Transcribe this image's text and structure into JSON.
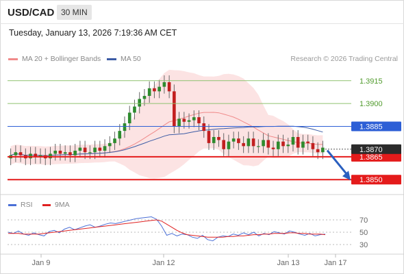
{
  "header": {
    "pair": "USD/CAD",
    "timeframe": "30 MIN"
  },
  "timestamp": "Tuesday, January 13, 2026 7:19:36 AM CET",
  "credit": "Research © 2026 Trading Central",
  "legend": {
    "ma_bb": {
      "label": "MA 20 + Bollinger Bands",
      "color": "#f08a8a"
    },
    "ma50": {
      "label": "MA 50",
      "color": "#3b5ba5"
    },
    "rsi": {
      "label": "RSI",
      "color": "#4a6fd6"
    },
    "ma9": {
      "label": "9MA",
      "color": "#e02020"
    }
  },
  "levels": [
    {
      "value": "1.3915",
      "kind": "target",
      "color": "#8dc26f"
    },
    {
      "value": "1.3900",
      "kind": "target",
      "color": "#8dc26f"
    },
    {
      "value": "1.3885",
      "kind": "pivot",
      "color": "#2d5fd6"
    },
    {
      "value": "1.3865",
      "kind": "support",
      "color": "#e41b1b"
    },
    {
      "value": "1.3850",
      "kind": "support",
      "color": "#e41b1b"
    }
  ],
  "last_price": "1.3870",
  "rsi_ticks": [
    "70",
    "50",
    "30"
  ],
  "x_ticks": [
    "Jan 9",
    "Jan 12",
    "Jan 13",
    "Jan 17"
  ],
  "chart_data": [
    {
      "type": "candlestick",
      "title": "USD/CAD 30 MIN",
      "ylim": [
        1.3842,
        1.3923
      ],
      "x": [
        "Jan 9",
        "Jan 12",
        "Jan 13",
        "Jan 17"
      ],
      "close": [
        1.3866,
        1.3868,
        1.3866,
        1.3864,
        1.3867,
        1.3865,
        1.3866,
        1.3864,
        1.3867,
        1.3869,
        1.3867,
        1.3868,
        1.3866,
        1.3869,
        1.3871,
        1.3868,
        1.3868,
        1.3871,
        1.3869,
        1.3872,
        1.3874,
        1.3877,
        1.3882,
        1.3887,
        1.3894,
        1.3898,
        1.3903,
        1.3905,
        1.391,
        1.3908,
        1.3911,
        1.3914,
        1.3908,
        1.3885,
        1.389,
        1.3888,
        1.3889,
        1.3891,
        1.3887,
        1.3882,
        1.3874,
        1.3878,
        1.3876,
        1.387,
        1.3875,
        1.3877,
        1.3874,
        1.3872,
        1.3877,
        1.3872,
        1.3872,
        1.3876,
        1.3871,
        1.387,
        1.3875,
        1.3872,
        1.3873,
        1.3878,
        1.3871,
        1.3875,
        1.3874,
        1.387,
        1.3868,
        1.3871
      ],
      "levels": [
        1.3915,
        1.39,
        1.3885,
        1.3865,
        1.385
      ],
      "last_price": 1.387
    },
    {
      "type": "line",
      "series": [
        {
          "name": "RSI",
          "values": [
            50,
            48,
            52,
            47,
            45,
            49,
            46,
            44,
            51,
            53,
            49,
            55,
            58,
            54,
            57,
            60,
            62,
            58,
            60,
            63,
            65,
            64,
            66,
            68,
            70,
            72,
            73,
            74,
            75,
            71,
            60,
            45,
            48,
            44,
            47,
            46,
            42,
            40,
            45,
            38,
            36,
            42,
            44,
            43,
            47,
            45,
            49,
            46,
            50,
            44,
            48,
            46,
            51,
            49,
            47,
            52,
            50,
            47,
            45,
            48,
            44,
            46,
            47
          ]
        },
        {
          "name": "9MA",
          "values": [
            48,
            48,
            48,
            47,
            47,
            47,
            47,
            48,
            49,
            50,
            51,
            52,
            53,
            54,
            55,
            56,
            57,
            58,
            59,
            60,
            61,
            62,
            63,
            64,
            65,
            66,
            67,
            68,
            69,
            70,
            68,
            63,
            58,
            53,
            49,
            46,
            45,
            44,
            43,
            42,
            42,
            42,
            42,
            43,
            43,
            44,
            44,
            45,
            46,
            46,
            47,
            47,
            48,
            48,
            48,
            49,
            49,
            48,
            48,
            47,
            47,
            47,
            46
          ]
        }
      ],
      "ylim": [
        20,
        80
      ]
    }
  ]
}
